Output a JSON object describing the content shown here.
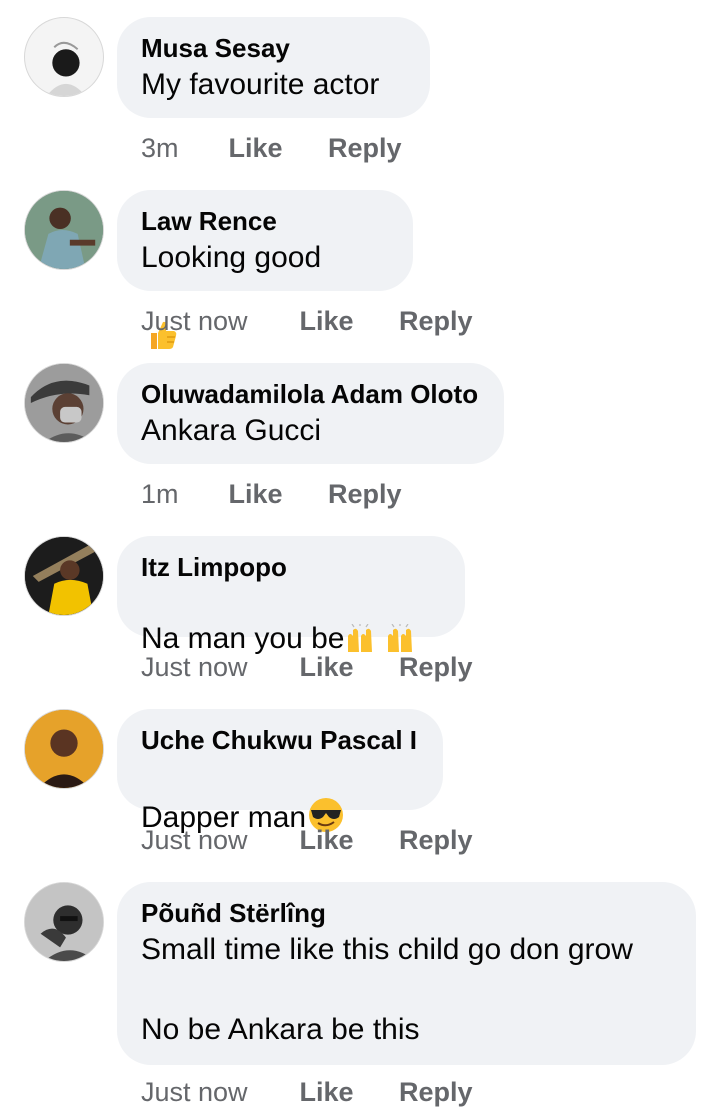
{
  "comments": [
    {
      "name": "Musa Sesay",
      "text": "My favourite actor",
      "time": "3m",
      "like": "Like",
      "reply": "Reply",
      "emoji": ""
    },
    {
      "name": "Law Rence",
      "text": "Looking good",
      "time": "Just now",
      "like": "Like",
      "reply": "Reply",
      "emoji": "thumbs-up-emoji"
    },
    {
      "name": "Oluwadamilola Adam Oloto",
      "text": "Ankara Gucci",
      "time": "1m",
      "like": "Like",
      "reply": "Reply",
      "emoji": ""
    },
    {
      "name": "Itz Limpopo",
      "text": "Na man you be",
      "time": "Just now",
      "like": "Like",
      "reply": "Reply",
      "emoji": "raising-hands-emoji"
    },
    {
      "name": "Uche Chukwu Pascal I",
      "text": "Dapper man",
      "time": "Just now",
      "like": "Like",
      "reply": "Reply",
      "emoji": "sunglasses-face-emoji"
    },
    {
      "name": "Põuñd Stërlîng",
      "text": "Small time like this child go don grow\n\nNo be Ankara be this",
      "time": "Just now",
      "like": "Like",
      "reply": "Reply",
      "emoji": ""
    }
  ],
  "colors": {
    "bubble": "#f0f2f5",
    "text": "#050505",
    "meta": "#65676b"
  }
}
